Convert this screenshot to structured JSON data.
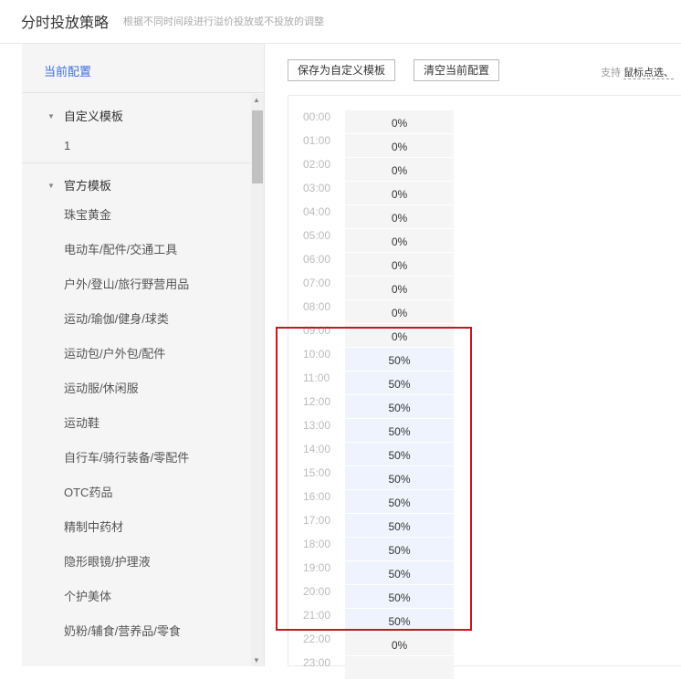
{
  "header": {
    "title": "分时投放策略",
    "subtitle": "根据不同时间段进行溢价投放或不投放的调整"
  },
  "sidebar": {
    "current": "当前配置",
    "groups": [
      {
        "label": "自定义模板",
        "items": [
          "1"
        ]
      },
      {
        "label": "官方模板",
        "items": [
          "珠宝黄金",
          "电动车/配件/交通工具",
          "户外/登山/旅行野营用品",
          "运动/瑜伽/健身/球类",
          "运动包/户外包/配件",
          "运动服/休闲服",
          "运动鞋",
          "自行车/骑行装备/零配件",
          "OTC药品",
          "精制中药材",
          "隐形眼镜/护理液",
          "个护美体",
          "奶粉/辅食/营养品/零食"
        ]
      }
    ]
  },
  "toolbar": {
    "save": "保存为自定义模板",
    "clear": "清空当前配置",
    "support_prefix": "支持",
    "support_link": "鼠标点选、"
  },
  "schedule": [
    {
      "time": "00:00",
      "value": "0%"
    },
    {
      "time": "01:00",
      "value": "0%"
    },
    {
      "time": "02:00",
      "value": "0%"
    },
    {
      "time": "03:00",
      "value": "0%"
    },
    {
      "time": "04:00",
      "value": "0%"
    },
    {
      "time": "05:00",
      "value": "0%"
    },
    {
      "time": "06:00",
      "value": "0%"
    },
    {
      "time": "07:00",
      "value": "0%"
    },
    {
      "time": "08:00",
      "value": "0%"
    },
    {
      "time": "09:00",
      "value": "0%"
    },
    {
      "time": "10:00",
      "value": "50%"
    },
    {
      "time": "11:00",
      "value": "50%"
    },
    {
      "time": "12:00",
      "value": "50%"
    },
    {
      "time": "13:00",
      "value": "50%"
    },
    {
      "time": "14:00",
      "value": "50%"
    },
    {
      "time": "15:00",
      "value": "50%"
    },
    {
      "time": "16:00",
      "value": "50%"
    },
    {
      "time": "17:00",
      "value": "50%"
    },
    {
      "time": "18:00",
      "value": "50%"
    },
    {
      "time": "19:00",
      "value": "50%"
    },
    {
      "time": "20:00",
      "value": "50%"
    },
    {
      "time": "21:00",
      "value": "50%"
    },
    {
      "time": "22:00",
      "value": "0%"
    },
    {
      "time": "23:00",
      "value": ""
    }
  ]
}
